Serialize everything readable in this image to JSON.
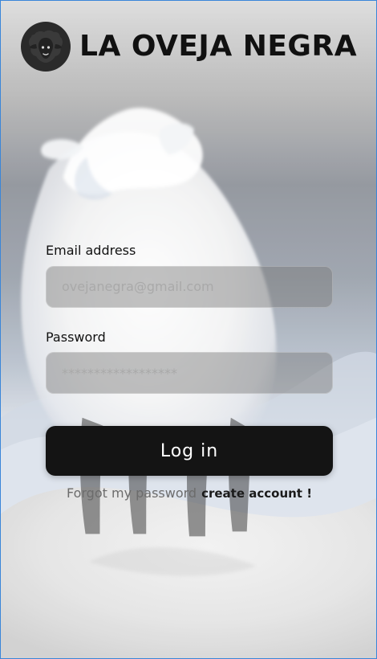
{
  "brand": {
    "name": "LA OVEJA NEGRA",
    "logo_icon": "sheep-head-icon"
  },
  "login_form": {
    "email_label": "Email address",
    "email_placeholder": "ovejanegra@gmail.com",
    "password_label": "Password",
    "password_placeholder": "******************",
    "login_button_label": "Log  in",
    "forgot_password_label": "Forgot my  password",
    "create_account_label": "create account !"
  },
  "colors": {
    "accent_dark": "#141414",
    "text_primary": "#111111",
    "text_muted": "#6c6c6c",
    "border_blue": "#3a86d9"
  }
}
